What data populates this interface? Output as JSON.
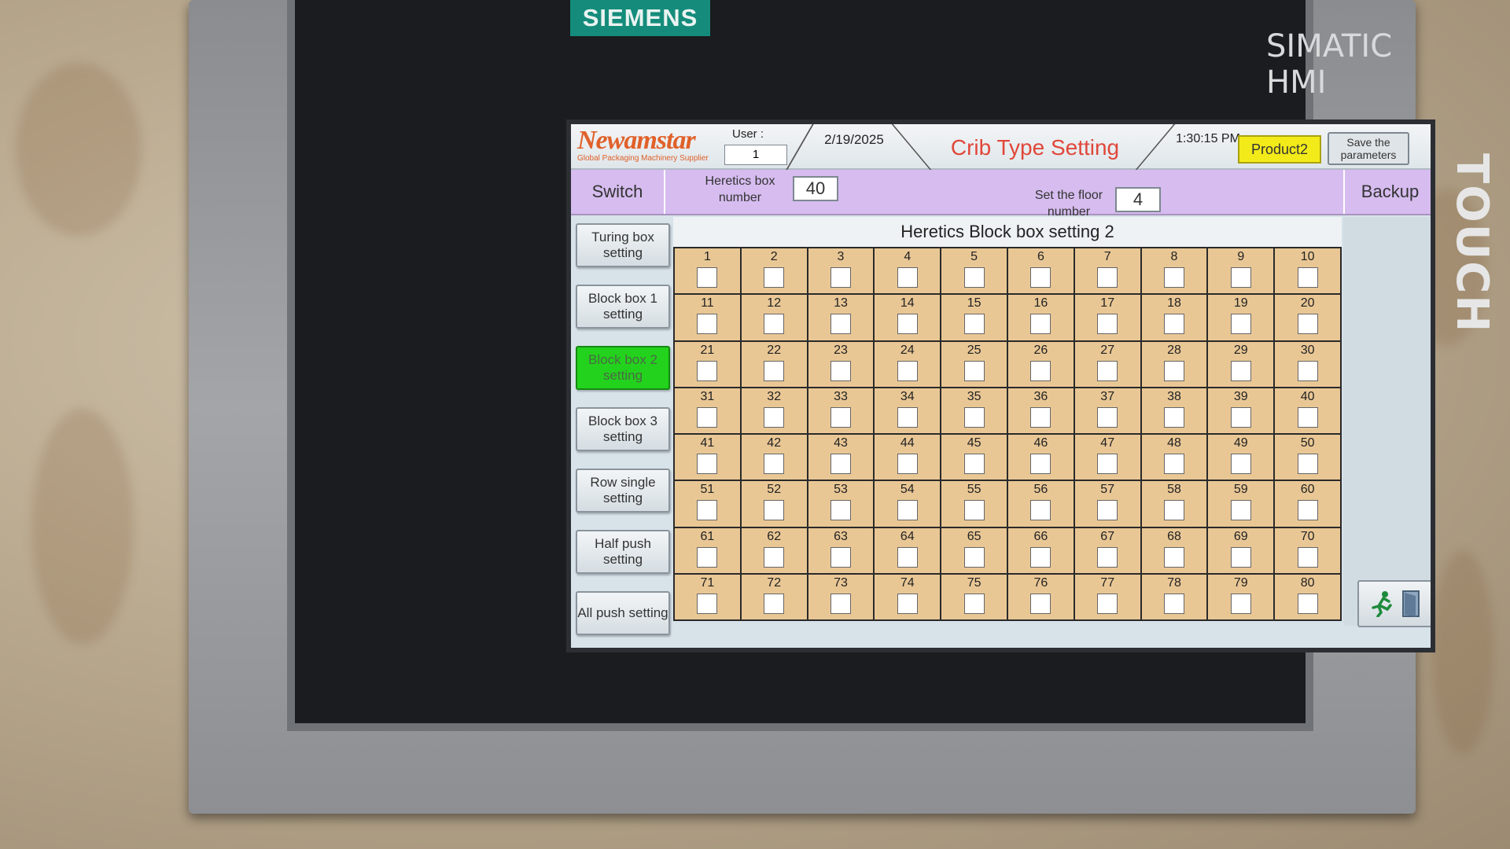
{
  "device": {
    "brand": "SIEMENS",
    "model": "SIMATIC HMI",
    "touch_label": "TOUCH"
  },
  "header": {
    "logo": "Newamstar",
    "logo_sub": "Global Packaging Machinery Supplier",
    "user_label": "User :",
    "user_value": "1",
    "date": "2/19/2025",
    "title": "Crib Type Setting",
    "time": "1:30:15 PM",
    "product_button": "Product2",
    "save_button": "Save the parameters"
  },
  "bar": {
    "switch_label": "Switch",
    "heretics_box_label": "Heretics box number",
    "heretics_box_value": "40",
    "floor_label": "Set the floor number",
    "floor_value": "4",
    "backup_label": "Backup"
  },
  "nav": [
    {
      "label": "Turing box setting",
      "active": false
    },
    {
      "label": "Block box 1 setting",
      "active": false
    },
    {
      "label": "Block box 2 setting",
      "active": true
    },
    {
      "label": "Block box 3 setting",
      "active": false
    },
    {
      "label": "Row single setting",
      "active": false
    },
    {
      "label": "Half push setting",
      "active": false
    },
    {
      "label": "All push setting",
      "active": false
    }
  ],
  "grid": {
    "title": "Heretics Block box setting 2",
    "cells": [
      "1",
      "2",
      "3",
      "4",
      "5",
      "6",
      "7",
      "8",
      "9",
      "10",
      "11",
      "12",
      "13",
      "14",
      "15",
      "16",
      "17",
      "18",
      "19",
      "20",
      "21",
      "22",
      "23",
      "24",
      "25",
      "26",
      "27",
      "28",
      "29",
      "30",
      "31",
      "32",
      "33",
      "34",
      "35",
      "36",
      "37",
      "38",
      "39",
      "40",
      "41",
      "42",
      "43",
      "44",
      "45",
      "46",
      "47",
      "48",
      "49",
      "50",
      "51",
      "52",
      "53",
      "54",
      "55",
      "56",
      "57",
      "58",
      "59",
      "60",
      "61",
      "62",
      "63",
      "64",
      "65",
      "66",
      "67",
      "68",
      "69",
      "70",
      "71",
      "72",
      "73",
      "74",
      "75",
      "76",
      "77",
      "78",
      "79",
      "80"
    ]
  },
  "colors": {
    "accent_purple": "#d6bcef",
    "active_green": "#23d21d",
    "product_yellow": "#f3ea1a",
    "cell_tan": "#e9c795",
    "title_red": "#e0473a"
  }
}
